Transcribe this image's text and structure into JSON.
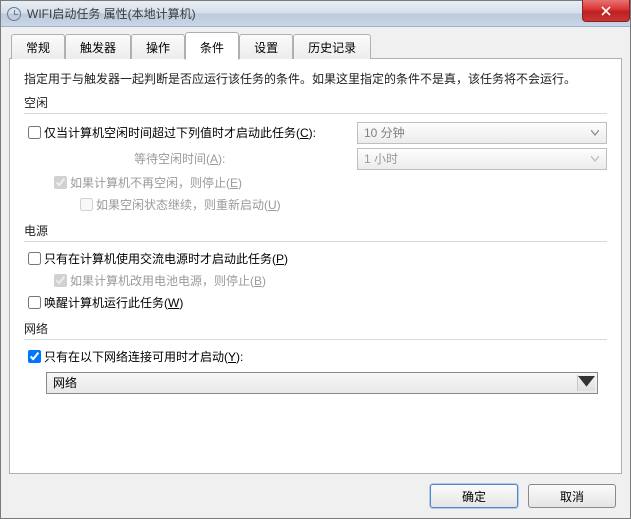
{
  "window": {
    "title": "WIFI启动任务 属性(本地计算机)"
  },
  "tabs": [
    {
      "label": "常规"
    },
    {
      "label": "触发器"
    },
    {
      "label": "操作"
    },
    {
      "label": "条件"
    },
    {
      "label": "设置"
    },
    {
      "label": "历史记录"
    }
  ],
  "active_tab_index": 3,
  "panel": {
    "description": "指定用于与触发器一起判断是否应运行该任务的条件。如果这里指定的条件不是真，该任务将不会运行。",
    "idle": {
      "section": "空闲",
      "start_if_idle": {
        "checked": false,
        "label_pre": "仅当计算机空闲时间超过下列值时才启动此任务(",
        "hotkey": "C",
        "label_post": "):"
      },
      "idle_duration": {
        "value": "10 分钟"
      },
      "wait_label_pre": "等待空闲时间(",
      "wait_hotkey": "A",
      "wait_label_post": "):",
      "wait_duration": {
        "value": "1 小时"
      },
      "stop_if_not_idle": {
        "checked": true,
        "label_pre": "如果计算机不再空闲，则停止(",
        "hotkey": "E",
        "label_post": ")"
      },
      "restart_if_idle": {
        "checked": false,
        "label_pre": "如果空闲状态继续，则重新启动(",
        "hotkey": "U",
        "label_post": ")"
      }
    },
    "power": {
      "section": "电源",
      "only_ac": {
        "checked": false,
        "label_pre": "只有在计算机使用交流电源时才启动此任务(",
        "hotkey": "P",
        "label_post": ")"
      },
      "stop_on_battery": {
        "checked": true,
        "label_pre": "如果计算机改用电池电源，则停止(",
        "hotkey": "B",
        "label_post": ")"
      },
      "wake": {
        "checked": false,
        "label_pre": "唤醒计算机运行此任务(",
        "hotkey": "W",
        "label_post": ")"
      }
    },
    "network": {
      "section": "网络",
      "only_if_network": {
        "checked": true,
        "label_pre": "只有在以下网络连接可用时才启动(",
        "hotkey": "Y",
        "label_post": "):"
      },
      "selected": "网络"
    }
  },
  "buttons": {
    "ok": "确定",
    "cancel": "取消"
  }
}
